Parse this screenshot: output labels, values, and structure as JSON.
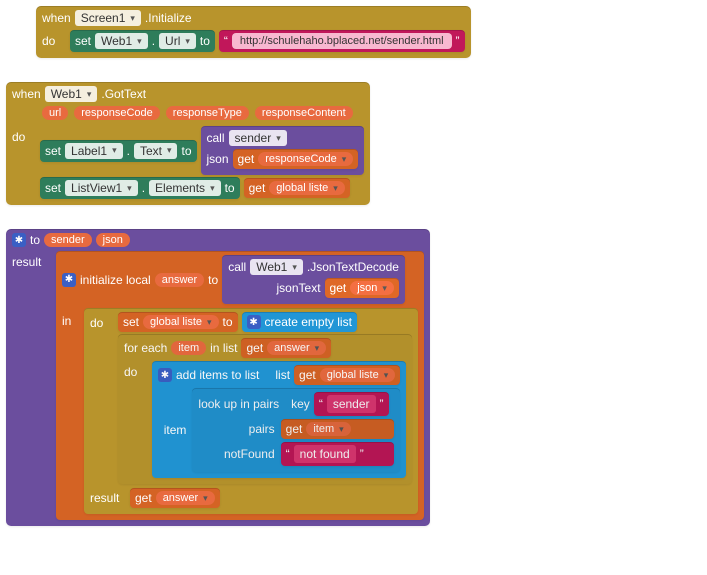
{
  "block1": {
    "when": "when",
    "component": "Screen1",
    "event": ".Initialize",
    "do": "do",
    "set": "set",
    "target_comp": "Web1",
    "dot": ".",
    "target_prop": "Url",
    "to": "to",
    "q1": "“",
    "url_text": "http://schulehaho.bplaced.net/sender.html",
    "q2": "”"
  },
  "block2": {
    "when": "when",
    "component": "Web1",
    "event": ".GotText",
    "params": {
      "url": "url",
      "responseCode": "responseCode",
      "responseType": "responseType",
      "responseContent": "responseContent"
    },
    "do": "do",
    "line1": {
      "set": "set",
      "comp": "Label1",
      "dot": ".",
      "prop": "Text",
      "to": "to",
      "call": "call",
      "proc": "sender",
      "arg_label": "json",
      "get": "get",
      "arg_var": "responseCode"
    },
    "line2": {
      "set": "set",
      "comp": "ListView1",
      "dot": ".",
      "prop": "Elements",
      "to": "to",
      "get": "get",
      "var": "global liste"
    }
  },
  "block3": {
    "to": "to",
    "proc": "sender",
    "arg": "json",
    "result_label": "result",
    "init": {
      "initialize": "initialize local",
      "var": "answer",
      "to": "to",
      "call": "call",
      "comp": "Web1",
      "method": ".JsonTextDecode",
      "param_label": "jsonText",
      "get": "get",
      "param_var": "json"
    },
    "in": "in",
    "do": "do",
    "setlist": {
      "set": "set",
      "var": "global liste",
      "to": "to",
      "create": "create empty list"
    },
    "foreach": {
      "for": "for each",
      "item": "item",
      "inlist": "in list",
      "get": "get",
      "var": "answer",
      "do": "do",
      "add": {
        "label": "add items to list",
        "list_label": "list",
        "get1": "get",
        "list_var": "global liste",
        "item_label": "item",
        "lookup": "look up in pairs",
        "key_label": "key",
        "key_q1": "“",
        "key_val": "sender",
        "key_q2": "”",
        "pairs_label": "pairs",
        "get2": "get",
        "pairs_var": "item",
        "nf_label": "notFound",
        "nf_q1": "“",
        "nf_val": "not found",
        "nf_q2": "”"
      }
    },
    "result_row": {
      "result": "result",
      "get": "get",
      "var": "answer"
    }
  }
}
